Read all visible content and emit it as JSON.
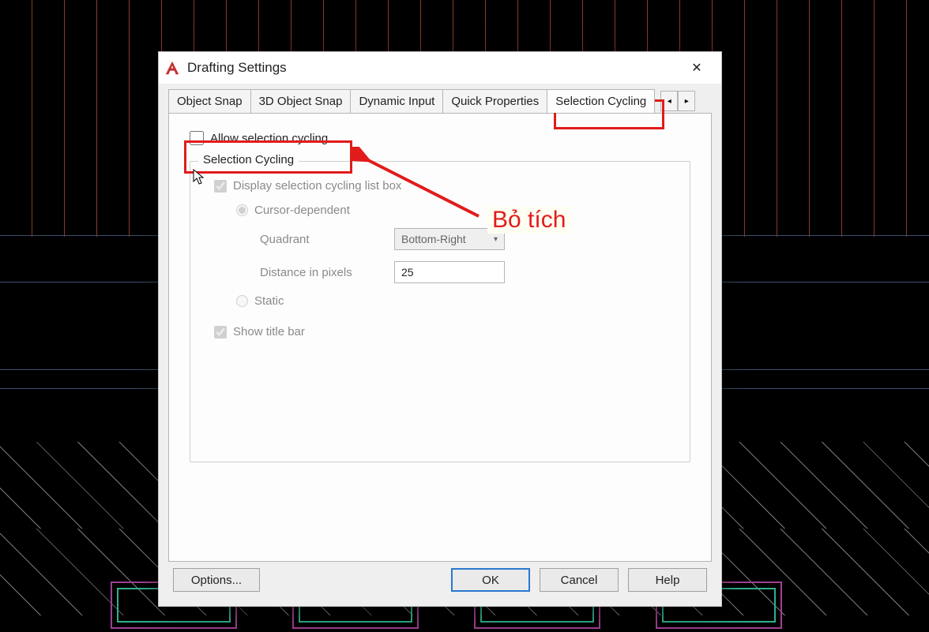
{
  "window": {
    "title": "Drafting Settings",
    "close_glyph": "✕"
  },
  "tabs": {
    "items": [
      "Object Snap",
      "3D Object Snap",
      "Dynamic Input",
      "Quick Properties",
      "Selection Cycling"
    ],
    "active_index": 4,
    "nav_left": "◂",
    "nav_right": "▸"
  },
  "pane": {
    "allow_label": "Allow selection cycling",
    "group_legend": "Selection Cycling",
    "display_listbox": "Display selection cycling list box",
    "cursor_dependent": "Cursor-dependent",
    "quadrant_label": "Quadrant",
    "quadrant_value": "Bottom-Right",
    "distance_label": "Distance in pixels",
    "distance_value": "25",
    "static_label": "Static",
    "show_titlebar": "Show title bar"
  },
  "footer": {
    "options": "Options...",
    "ok": "OK",
    "cancel": "Cancel",
    "help": "Help"
  },
  "annotation": {
    "uncheck_hint": "Bỏ tích"
  }
}
